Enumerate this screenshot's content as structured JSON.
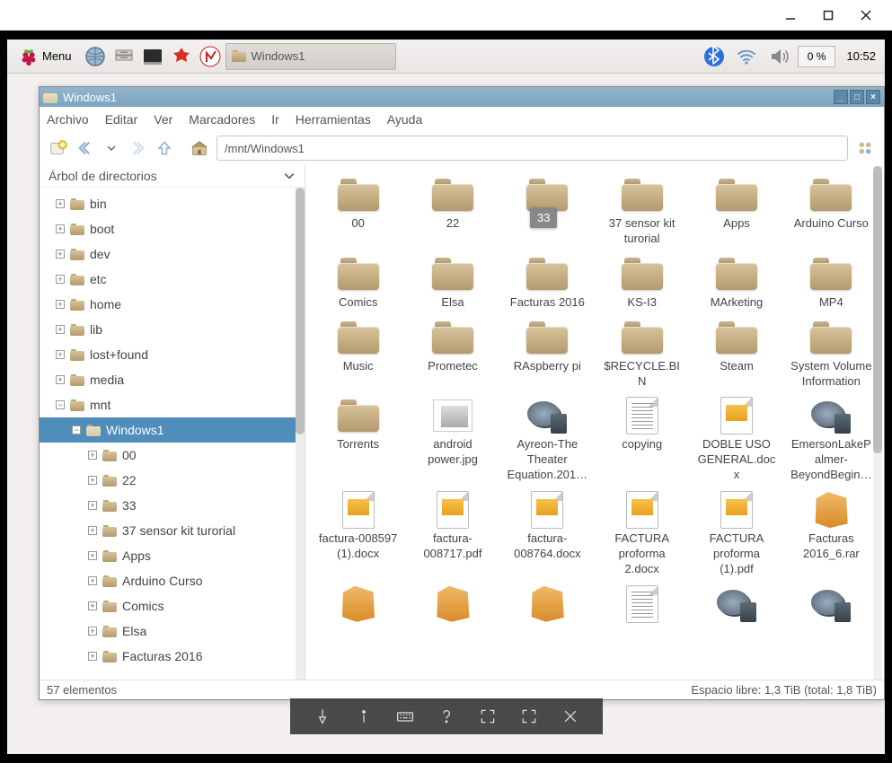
{
  "host": {
    "minimize": "—",
    "maximize": "☐",
    "close": "✕"
  },
  "panel": {
    "menu_label": "Menu",
    "taskbar_item": "Windows1",
    "cpu": "0 %",
    "clock": "10:52"
  },
  "fm": {
    "title": "Windows1",
    "menubar": [
      "Archivo",
      "Editar",
      "Ver",
      "Marcadores",
      "Ir",
      "Herramientas",
      "Ayuda"
    ],
    "path": "/mnt/Windows1",
    "sidebar_header": "Árbol de directorios",
    "tree": [
      {
        "label": "bin",
        "depth": 1,
        "exp": "+"
      },
      {
        "label": "boot",
        "depth": 1,
        "exp": "+"
      },
      {
        "label": "dev",
        "depth": 1,
        "exp": "+"
      },
      {
        "label": "etc",
        "depth": 1,
        "exp": "+"
      },
      {
        "label": "home",
        "depth": 1,
        "exp": "+"
      },
      {
        "label": "lib",
        "depth": 1,
        "exp": "+"
      },
      {
        "label": "lost+found",
        "depth": 1,
        "exp": "+"
      },
      {
        "label": "media",
        "depth": 1,
        "exp": "+"
      },
      {
        "label": "mnt",
        "depth": 1,
        "exp": "−"
      },
      {
        "label": "Windows1",
        "depth": 2,
        "exp": "−",
        "sel": true
      },
      {
        "label": "00",
        "depth": 3,
        "exp": "+"
      },
      {
        "label": "22",
        "depth": 3,
        "exp": "+"
      },
      {
        "label": "33",
        "depth": 3,
        "exp": "+"
      },
      {
        "label": "37 sensor kit turorial",
        "depth": 3,
        "exp": "+"
      },
      {
        "label": "Apps",
        "depth": 3,
        "exp": "+"
      },
      {
        "label": "Arduino Curso",
        "depth": 3,
        "exp": "+"
      },
      {
        "label": "Comics",
        "depth": 3,
        "exp": "+"
      },
      {
        "label": "Elsa",
        "depth": 3,
        "exp": "+"
      },
      {
        "label": "Facturas 2016",
        "depth": 3,
        "exp": "+"
      }
    ],
    "drag_badge": "33",
    "files": [
      {
        "name": "00",
        "type": "folder"
      },
      {
        "name": "22",
        "type": "folder"
      },
      {
        "name": "33",
        "type": "folder"
      },
      {
        "name": "37 sensor kit turorial",
        "type": "folder"
      },
      {
        "name": "Apps",
        "type": "folder"
      },
      {
        "name": "Arduino Curso",
        "type": "folder"
      },
      {
        "name": "Comics",
        "type": "folder"
      },
      {
        "name": "Elsa",
        "type": "folder"
      },
      {
        "name": "Facturas 2016",
        "type": "folder"
      },
      {
        "name": "KS-I3",
        "type": "folder"
      },
      {
        "name": "MArketing",
        "type": "folder"
      },
      {
        "name": "MP4",
        "type": "folder"
      },
      {
        "name": "Music",
        "type": "folder"
      },
      {
        "name": "Prometec",
        "type": "folder"
      },
      {
        "name": "RAspberry pi",
        "type": "folder"
      },
      {
        "name": "$RECYCLE.BIN",
        "type": "folder"
      },
      {
        "name": "Steam",
        "type": "folder"
      },
      {
        "name": "System Volume Information",
        "type": "folder"
      },
      {
        "name": "Torrents",
        "type": "folder"
      },
      {
        "name": "android power.jpg",
        "type": "image"
      },
      {
        "name": "Ayreon-The Theater Equation.201…",
        "type": "video"
      },
      {
        "name": "copying",
        "type": "text"
      },
      {
        "name": "DOBLE USO GENERAL.docx",
        "type": "docimg"
      },
      {
        "name": "EmersonLakePalmer-BeyondBegin…",
        "type": "video"
      },
      {
        "name": "factura-008597 (1).docx",
        "type": "docimg"
      },
      {
        "name": "factura-008717.pdf",
        "type": "docimg"
      },
      {
        "name": "factura-008764.docx",
        "type": "docimg"
      },
      {
        "name": "FACTURA proforma 2.docx",
        "type": "docimg"
      },
      {
        "name": "FACTURA proforma (1).pdf",
        "type": "docimg"
      },
      {
        "name": "Facturas 2016_6.rar",
        "type": "rar"
      },
      {
        "name": "",
        "type": "rar"
      },
      {
        "name": "",
        "type": "rar"
      },
      {
        "name": "",
        "type": "rar"
      },
      {
        "name": "",
        "type": "text"
      },
      {
        "name": "",
        "type": "video"
      },
      {
        "name": "",
        "type": "video"
      }
    ],
    "status_left": "57 elementos",
    "status_right": "Espacio libre: 1,3 TiB (total: 1,8 TiB)"
  }
}
